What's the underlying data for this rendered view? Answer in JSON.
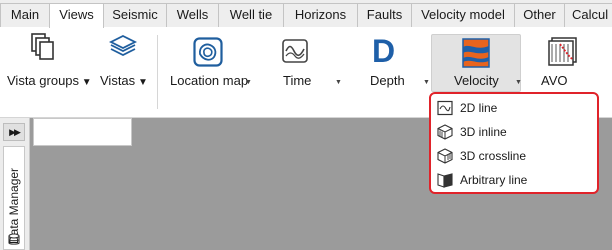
{
  "tabs": [
    {
      "label": "Main"
    },
    {
      "label": "Views",
      "active": true
    },
    {
      "label": "Seismic"
    },
    {
      "label": "Wells"
    },
    {
      "label": "Well tie"
    },
    {
      "label": "Horizons"
    },
    {
      "label": "Faults"
    },
    {
      "label": "Velocity model"
    },
    {
      "label": "Other"
    },
    {
      "label": "Calcul"
    }
  ],
  "ribbon": {
    "vista_groups": "Vista groups",
    "vistas": "Vistas",
    "location_map": "Location map",
    "time": "Time",
    "depth": "Depth",
    "velocity": "Velocity",
    "avo": "AVO"
  },
  "side_panel": {
    "data_manager": "Data Manager"
  },
  "velocity_menu": {
    "items": [
      {
        "label": "2D line",
        "icon": "line-2d-icon"
      },
      {
        "label": "3D inline",
        "icon": "cube-inline-icon"
      },
      {
        "label": "3D crossline",
        "icon": "cube-crossline-icon"
      },
      {
        "label": "Arbitrary line",
        "icon": "arbitrary-line-icon"
      }
    ]
  },
  "colors": {
    "highlight_border": "#e0232a",
    "depth_blue": "#1e5fa8",
    "velocity_orange": "#e8641e"
  }
}
